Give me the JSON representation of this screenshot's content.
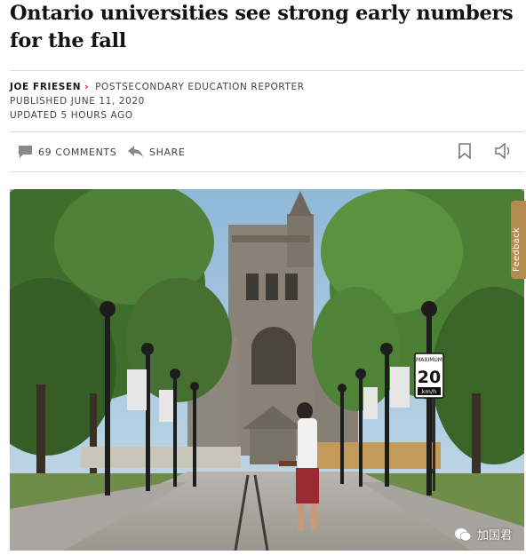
{
  "article": {
    "headline": "Ontario universities see strong early numbers for the fall",
    "author": "JOE FRIESEN",
    "author_role": "POSTSECONDARY EDUCATION REPORTER",
    "published": "PUBLISHED JUNE 11, 2020",
    "updated": "UPDATED 5 HOURS AGO"
  },
  "toolbar": {
    "comments_label": "69 COMMENTS",
    "share_label": "SHARE"
  },
  "hero": {
    "sign_top": "MAXIMUM",
    "sign_number": "20",
    "sign_unit": "km/h"
  },
  "feedback": {
    "label": "Feedback"
  },
  "watermark": {
    "text": "加国君"
  },
  "colors": {
    "accent_red": "#d0111b",
    "feedback_tab": "#b48a4e"
  }
}
